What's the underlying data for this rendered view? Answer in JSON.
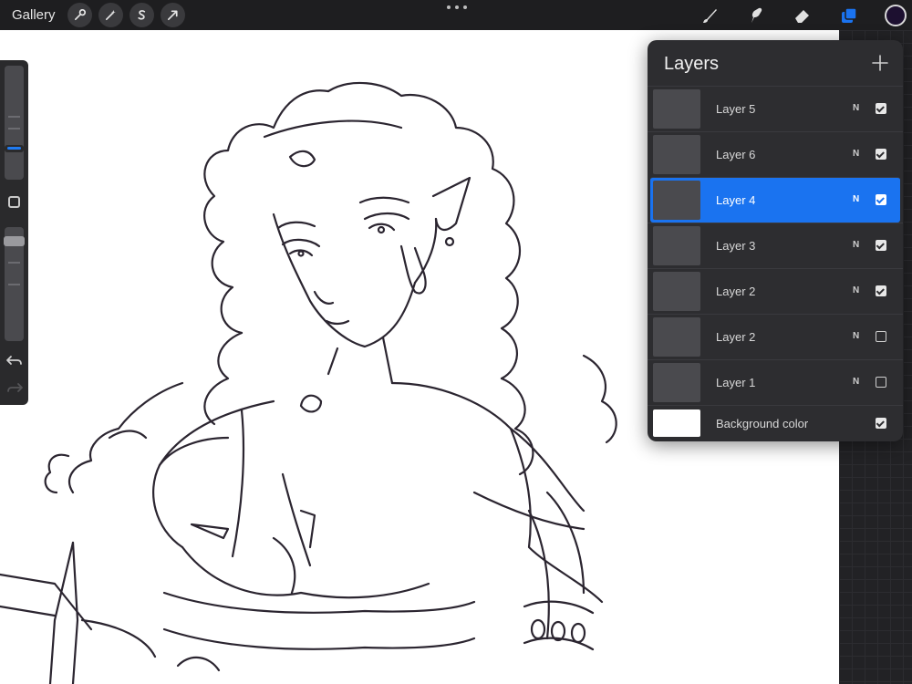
{
  "topbar": {
    "gallery_label": "Gallery",
    "left_tools": [
      "wrench-icon",
      "magic-wand-icon",
      "selection-s-icon",
      "transform-arrow-icon"
    ],
    "right_tools": [
      "brush-icon",
      "smudge-icon",
      "eraser-icon",
      "layers-icon"
    ],
    "active_color": "#1d1030",
    "accent": "#1a73f0"
  },
  "sidebar": {
    "brush_size_level": 0.27,
    "brush_opacity_level": 0.08
  },
  "layers": {
    "title": "Layers",
    "items": [
      {
        "name": "Layer 5",
        "blend": "N",
        "visible": true,
        "selected": false
      },
      {
        "name": "Layer 6",
        "blend": "N",
        "visible": true,
        "selected": false
      },
      {
        "name": "Layer 4",
        "blend": "N",
        "visible": true,
        "selected": true
      },
      {
        "name": "Layer 3",
        "blend": "N",
        "visible": true,
        "selected": false
      },
      {
        "name": "Layer 2",
        "blend": "N",
        "visible": true,
        "selected": false
      },
      {
        "name": "Layer 2",
        "blend": "N",
        "visible": false,
        "selected": false
      },
      {
        "name": "Layer 1",
        "blend": "N",
        "visible": false,
        "selected": false
      }
    ],
    "background": {
      "name": "Background color",
      "visible": true
    }
  }
}
